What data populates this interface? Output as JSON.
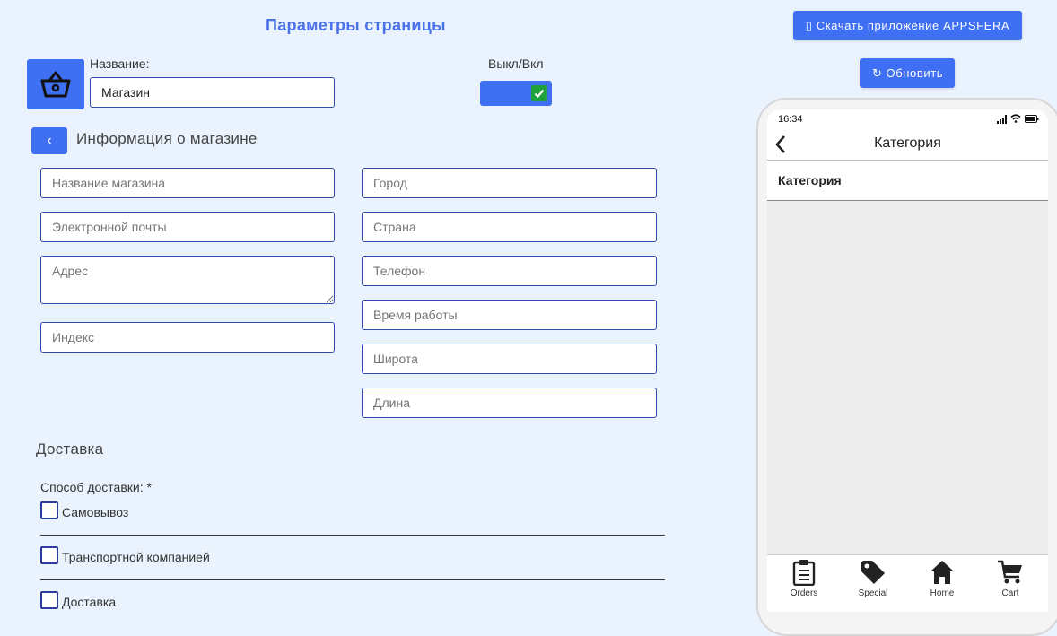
{
  "page": {
    "title": "Параметры страницы"
  },
  "top_actions": {
    "download_label": "▯ Скачать приложение APPSFERA",
    "refresh_label": "↻ Обновить"
  },
  "name_field": {
    "label": "Название:",
    "value": "Магазин"
  },
  "toggle": {
    "label": "Выкл/Вкл",
    "checked": true
  },
  "store_info": {
    "back_label": "‹",
    "title": "Информация о магазине",
    "left_fields": [
      "Название магазина",
      "Электронной почты",
      "Адрес",
      "Индекс"
    ],
    "right_fields": [
      "Город",
      "Страна",
      "Телефон",
      "Время работы",
      "Широта",
      "Длина"
    ]
  },
  "delivery": {
    "title": "Доставка",
    "method_label": "Способ доставки: *",
    "options": [
      "Самовывоз",
      "Транспортной компанией",
      "Доставка"
    ]
  },
  "phone_preview": {
    "time": "16:34",
    "nav_title": "Категория",
    "category_row": "Категория",
    "tabs": [
      {
        "label": "Orders",
        "icon": "clipboard-icon"
      },
      {
        "label": "Special",
        "icon": "tag-icon"
      },
      {
        "label": "Home",
        "icon": "home-icon"
      },
      {
        "label": "Cart",
        "icon": "cart-icon"
      }
    ]
  },
  "colors": {
    "accent": "#3f6ff2",
    "title": "#4a72e8",
    "background": "#eaf3fd",
    "toggle_check": "#20a23a"
  }
}
